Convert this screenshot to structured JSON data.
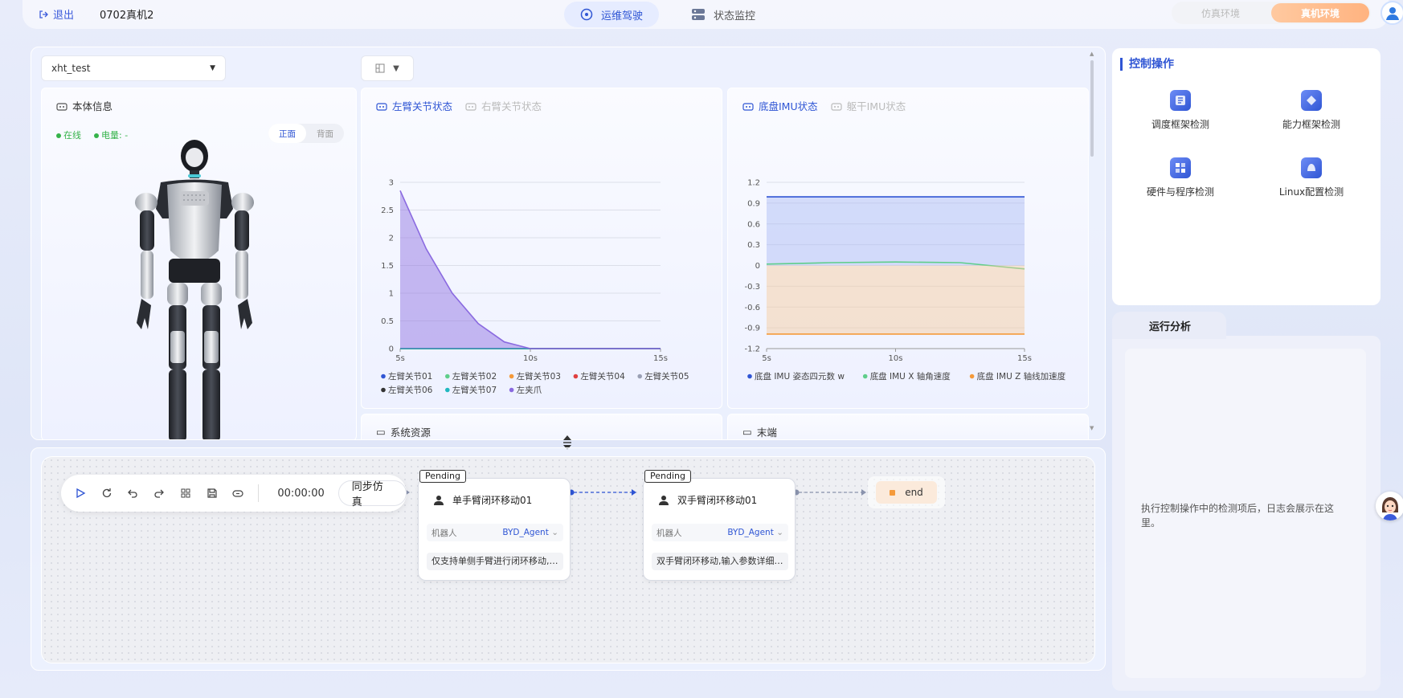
{
  "topbar": {
    "exit_label": "退出",
    "robot_name": "0702真机2",
    "tabs": [
      {
        "label": "运维驾驶",
        "active": true
      },
      {
        "label": "状态监控",
        "active": false
      }
    ],
    "env": {
      "sim": "仿真环境",
      "real": "真机环境",
      "active": "real"
    }
  },
  "workspace": {
    "selected_robot": "xht_test"
  },
  "body_info": {
    "title": "本体信息",
    "online_label": "在线",
    "battery_label": "电量:",
    "battery_value": "-",
    "view_front": "正面",
    "view_back": "背面",
    "active_view": "front"
  },
  "arm_chart": {
    "tabs": [
      "左臂关节状态",
      "右臂关节状态"
    ],
    "active_tab": 0,
    "chart_data": {
      "type": "area",
      "x": [
        5,
        6,
        7,
        8,
        9,
        10,
        11,
        12,
        13,
        14,
        15
      ],
      "x_tick_labels": [
        "5s",
        "10s",
        "15s"
      ],
      "ylim": [
        0,
        3
      ],
      "y_ticks": [
        "0",
        "0.5",
        "1",
        "1.5",
        "2",
        "2.5",
        "3"
      ],
      "series": [
        {
          "name": "左臂关节01",
          "color": "#2f55d4",
          "values": [
            0,
            0,
            0,
            0,
            0,
            0,
            0,
            0,
            0,
            0,
            0
          ]
        },
        {
          "name": "左臂关节02",
          "color": "#5fce8a",
          "values": [
            0,
            0,
            0,
            0,
            0,
            0,
            0,
            0,
            0,
            0,
            0
          ]
        },
        {
          "name": "左臂关节03",
          "color": "#f59a3a",
          "values": [
            0,
            0,
            0,
            0,
            0,
            0,
            0,
            0,
            0,
            0,
            0
          ]
        },
        {
          "name": "左臂关节04",
          "color": "#e04040",
          "values": [
            0,
            0,
            0,
            0,
            0,
            0,
            0,
            0,
            0,
            0,
            0
          ]
        },
        {
          "name": "左臂关节05",
          "color": "#9aa0b4",
          "values": [
            0,
            0,
            0,
            0,
            0,
            0,
            0,
            0,
            0,
            0,
            0
          ]
        },
        {
          "name": "左臂关节06",
          "color": "#333333",
          "values": [
            0,
            0,
            0,
            0,
            0,
            0,
            0,
            0,
            0,
            0,
            0
          ]
        },
        {
          "name": "左臂关节07",
          "color": "#20b8c0",
          "values": [
            0,
            0,
            0,
            0,
            0,
            0,
            0,
            0,
            0,
            0,
            0
          ]
        },
        {
          "name": "左夹爪",
          "color": "#8a6ae0",
          "values": [
            2.85,
            1.8,
            1.0,
            0.45,
            0.12,
            0,
            0,
            0,
            0,
            0,
            0
          ],
          "fill": true
        }
      ]
    }
  },
  "imu_chart": {
    "tabs": [
      "底盘IMU状态",
      "躯干IMU状态"
    ],
    "active_tab": 0,
    "chart_data": {
      "type": "area",
      "x": [
        5,
        7.5,
        10,
        12.5,
        15
      ],
      "x_tick_labels": [
        "5s",
        "10s",
        "15s"
      ],
      "ylim": [
        -1.2,
        1.2
      ],
      "y_ticks": [
        "-1.2",
        "-0.9",
        "-0.6",
        "-0.3",
        "0",
        "0.3",
        "0.6",
        "0.9",
        "1.2"
      ],
      "series": [
        {
          "name": "底盘 IMU 姿态四元数 w",
          "color": "#2f55d4",
          "values": [
            0.99,
            0.99,
            0.99,
            0.99,
            0.99
          ],
          "fill": "#a9b8f5"
        },
        {
          "name": "底盘 IMU X 轴角速度",
          "color": "#5fce8a",
          "values": [
            0.02,
            0.04,
            0.05,
            0.04,
            -0.05
          ]
        },
        {
          "name": "底盘 IMU Z 轴线加速度",
          "color": "#f59a3a",
          "values": [
            -0.99,
            -0.99,
            -0.99,
            -0.99,
            -0.99
          ],
          "fill": "#f7c99a"
        }
      ]
    }
  },
  "lower_cards": [
    "系统资源",
    "末端"
  ],
  "flow": {
    "timer": "00:00:00",
    "sync_label": "同步仿真",
    "nodes": [
      {
        "status": "Pending",
        "title": "单手臂闭环移动01",
        "robot_label": "机器人",
        "robot_value": "BYD_Agent",
        "desc": "仅支持单侧手臂进行闭环移动,输入参数详细"
      },
      {
        "status": "Pending",
        "title": "双手臂闭环移动01",
        "robot_label": "机器人",
        "robot_value": "BYD_Agent",
        "desc": "双手臂闭环移动,输入参数详细说明"
      }
    ],
    "end_label": "end"
  },
  "control": {
    "title": "控制操作",
    "items": [
      {
        "label": "调度框架检测",
        "icon": "schedule-icon"
      },
      {
        "label": "能力框架检测",
        "icon": "capability-icon"
      },
      {
        "label": "硬件与程序检测",
        "icon": "hardware-icon"
      },
      {
        "label": "Linux配置检测",
        "icon": "linux-icon"
      }
    ]
  },
  "analysis": {
    "tab": "运行分析",
    "message": "执行控制操作中的检测项后，日志会展示在这里。"
  }
}
